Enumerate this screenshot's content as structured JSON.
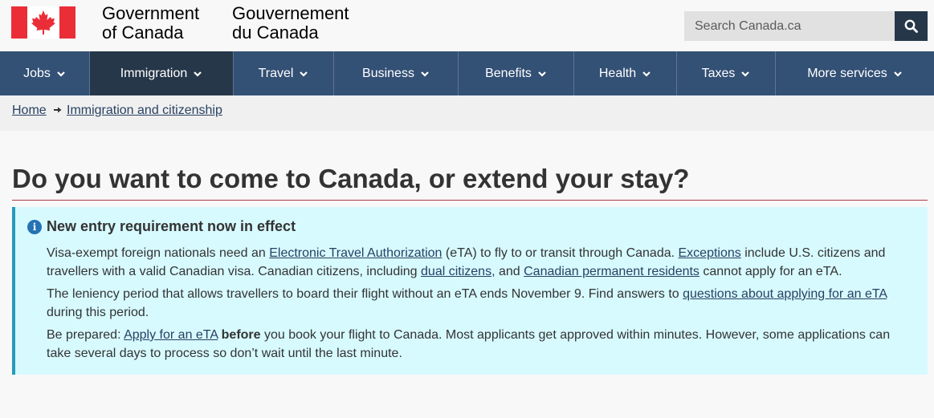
{
  "header": {
    "wordmark_en_1": "Government",
    "wordmark_en_2": "of Canada",
    "wordmark_fr_1": "Gouvernement",
    "wordmark_fr_2": "du Canada",
    "search_placeholder": "Search Canada.ca"
  },
  "nav": {
    "items": [
      {
        "label": "Jobs"
      },
      {
        "label": "Immigration"
      },
      {
        "label": "Travel"
      },
      {
        "label": "Business"
      },
      {
        "label": "Benefits"
      },
      {
        "label": "Health"
      },
      {
        "label": "Taxes"
      },
      {
        "label": "More services"
      }
    ]
  },
  "breadcrumb": {
    "home": "Home",
    "immigration": "Immigration and citizenship"
  },
  "main": {
    "title": "Do you want to come to Canada, or extend your stay?"
  },
  "alert": {
    "heading": "New entry requirement now in effect",
    "p1": {
      "t1": "Visa-exempt foreign nationals need an ",
      "link1": "Electronic Travel Authorization",
      "t2": " (eTA) to fly to or transit through Canada. ",
      "link2": "Exceptions",
      "t3": " include U.S. citizens and travellers with a valid Canadian visa. Canadian citizens, including ",
      "link3": "dual citizens,",
      "t4": " and ",
      "link4": "Canadian permanent residents",
      "t5": " cannot apply for an eTA."
    },
    "p2": {
      "t1": "The leniency period that allows travellers to board their flight without an eTA ends November 9. Find answers to ",
      "link1": "questions about applying for an eTA",
      "t2": " during this period."
    },
    "p3": {
      "t1": "Be prepared: ",
      "link1": "Apply for an eTA",
      "bold": "before",
      "t2": " you book your flight to Canada. Most applicants get approved within minutes. However, some applications can take several days to process so don’t wait until the last minute."
    }
  },
  "colors": {
    "nav": "#335075",
    "nav_active": "#26374a",
    "link": "#284162",
    "alert_bg": "#d7faff",
    "alert_border": "#269abc",
    "flag_red": "#eb2d37"
  }
}
